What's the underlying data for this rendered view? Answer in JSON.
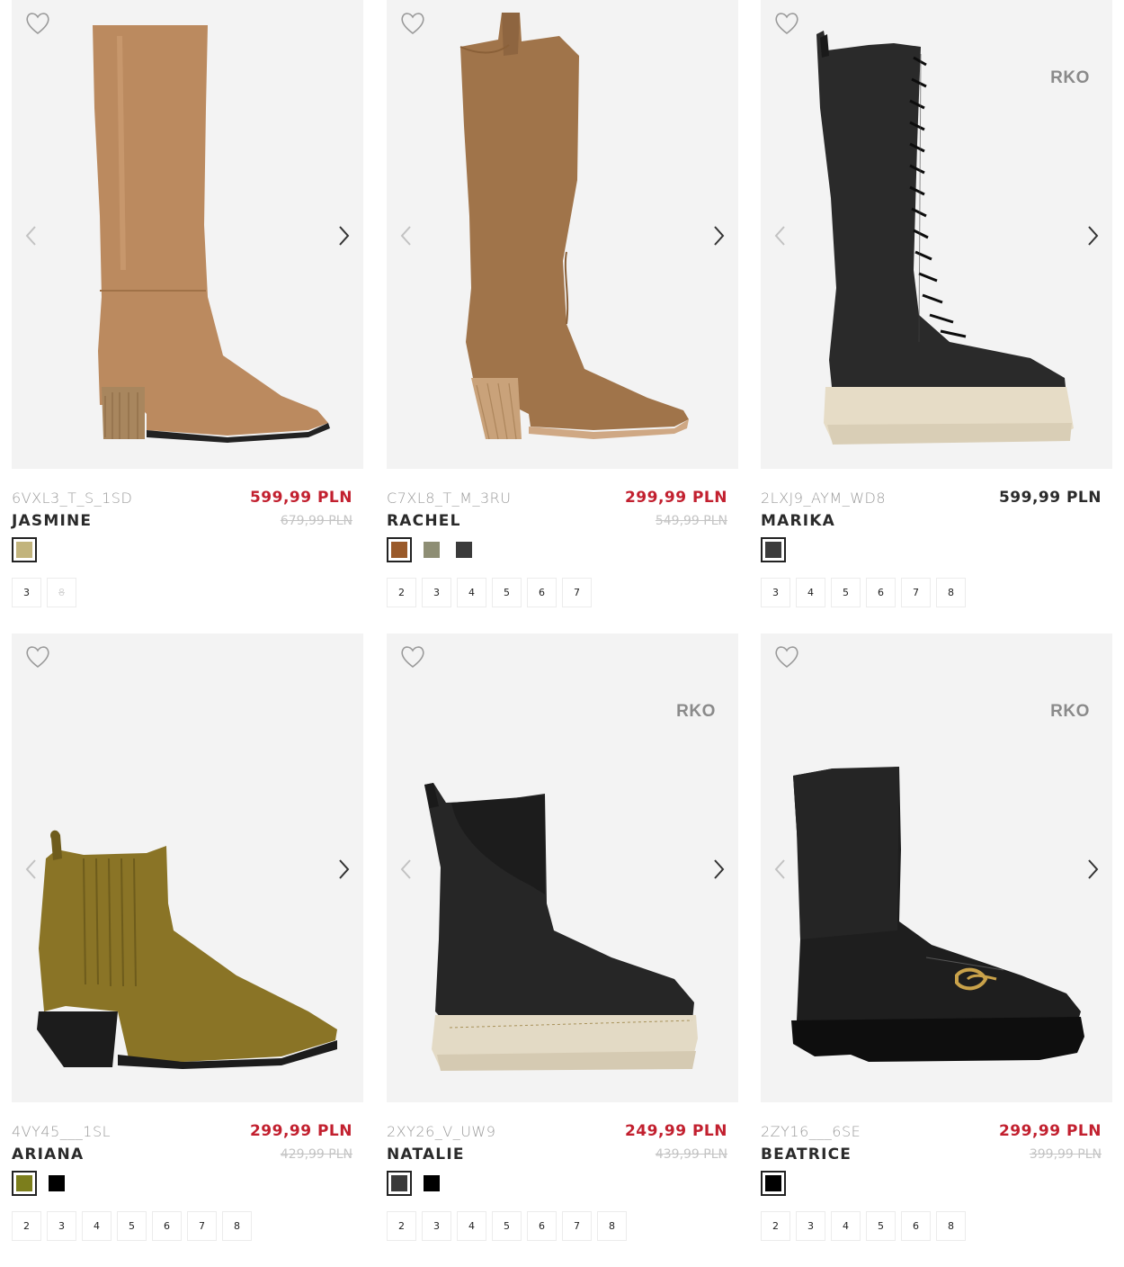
{
  "products": [
    {
      "sku": "6VXL3_T_S_1SD",
      "name": "JASMINE",
      "price": "599,99 PLN",
      "old_price": "679,99 PLN",
      "price_style": "sale",
      "badge": "",
      "image": "tall-leather-boot-tan",
      "colors": [
        "#c2b47d"
      ],
      "active_color": 0,
      "sizes": [
        {
          "label": "3",
          "available": true
        },
        {
          "label": "8",
          "available": false
        }
      ]
    },
    {
      "sku": "C7XL8_T_M_3RU",
      "name": "RACHEL",
      "price": "299,99 PLN",
      "old_price": "549,99 PLN",
      "price_style": "sale",
      "badge": "",
      "image": "tall-suede-western-boot",
      "colors": [
        "#9a5a2a",
        "#8e8e74",
        "#3a3a3a"
      ],
      "active_color": 0,
      "sizes": [
        {
          "label": "2",
          "available": true
        },
        {
          "label": "3",
          "available": true
        },
        {
          "label": "4",
          "available": true
        },
        {
          "label": "5",
          "available": true
        },
        {
          "label": "6",
          "available": true
        },
        {
          "label": "7",
          "available": true
        }
      ]
    },
    {
      "sku": "2LXJ9_AYM_WD8",
      "name": "MARIKA",
      "price": "599,99 PLN",
      "old_price": "",
      "price_style": "regular",
      "badge": "RKO",
      "image": "tall-lace-up-platform-boot",
      "colors": [
        "#3c3c3c"
      ],
      "active_color": 0,
      "sizes": [
        {
          "label": "3",
          "available": true
        },
        {
          "label": "4",
          "available": true
        },
        {
          "label": "5",
          "available": true
        },
        {
          "label": "6",
          "available": true
        },
        {
          "label": "7",
          "available": true
        },
        {
          "label": "8",
          "available": true
        }
      ]
    },
    {
      "sku": "4VY45___1SL",
      "name": "ARIANA",
      "price": "299,99 PLN",
      "old_price": "429,99 PLN",
      "price_style": "sale",
      "badge": "",
      "image": "suede-chelsea-ankle-boot",
      "colors": [
        "#7c7e1c",
        "#000000"
      ],
      "active_color": 0,
      "sizes": [
        {
          "label": "2",
          "available": true
        },
        {
          "label": "3",
          "available": true
        },
        {
          "label": "4",
          "available": true
        },
        {
          "label": "5",
          "available": true
        },
        {
          "label": "6",
          "available": true
        },
        {
          "label": "7",
          "available": true
        },
        {
          "label": "8",
          "available": true
        }
      ]
    },
    {
      "sku": "2XY26_V_UW9",
      "name": "NATALIE",
      "price": "249,99 PLN",
      "old_price": "439,99 PLN",
      "price_style": "sale",
      "badge": "RKO",
      "image": "chunky-chelsea-boot",
      "colors": [
        "#3a3a3a",
        "#000000"
      ],
      "active_color": 0,
      "sizes": [
        {
          "label": "2",
          "available": true
        },
        {
          "label": "3",
          "available": true
        },
        {
          "label": "4",
          "available": true
        },
        {
          "label": "5",
          "available": true
        },
        {
          "label": "6",
          "available": true
        },
        {
          "label": "7",
          "available": true
        },
        {
          "label": "8",
          "available": true
        }
      ]
    },
    {
      "sku": "2ZY16___6SE",
      "name": "BEATRICE",
      "price": "299,99 PLN",
      "old_price": "399,99 PLN",
      "price_style": "sale",
      "badge": "RKO",
      "image": "sock-loafer-boot",
      "colors": [
        "#000000"
      ],
      "active_color": 0,
      "sizes": [
        {
          "label": "2",
          "available": true
        },
        {
          "label": "3",
          "available": true
        },
        {
          "label": "4",
          "available": true
        },
        {
          "label": "5",
          "available": true
        },
        {
          "label": "6",
          "available": true
        },
        {
          "label": "8",
          "available": true
        }
      ]
    }
  ],
  "icons": {
    "favorite": "heart-outline-icon",
    "prev": "chevron-left-icon",
    "next": "chevron-right-icon"
  }
}
